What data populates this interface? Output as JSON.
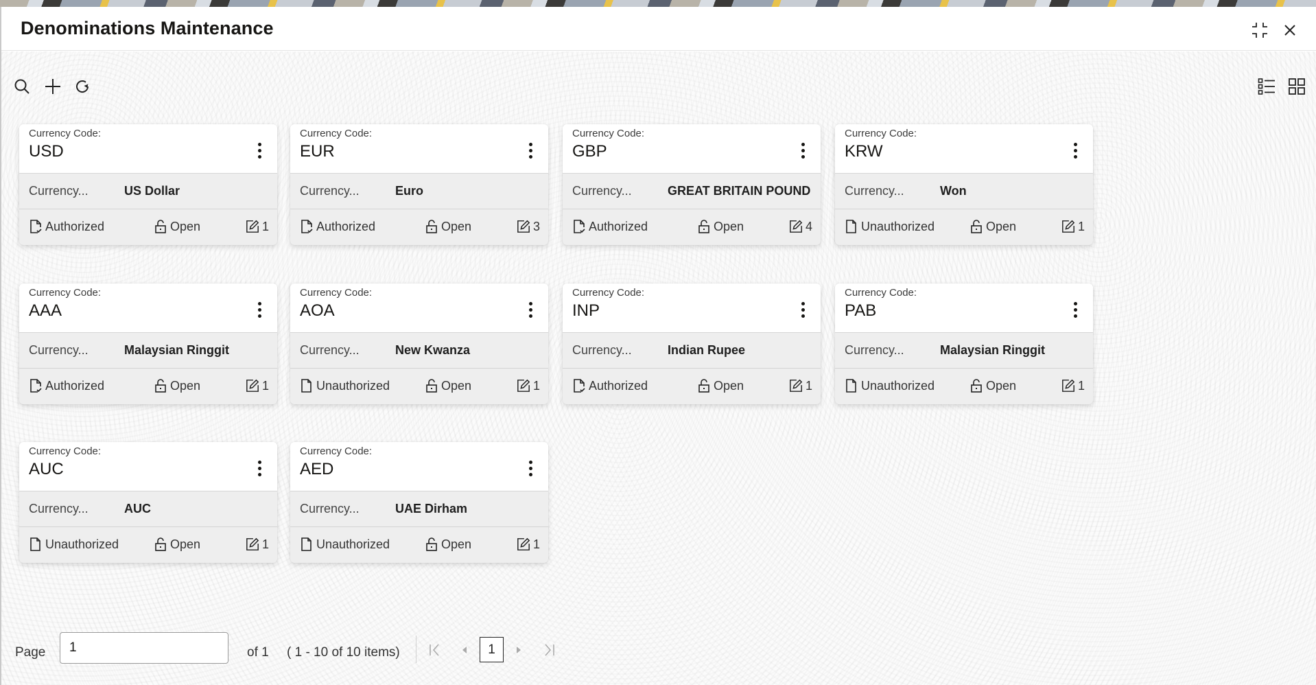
{
  "window": {
    "title": "Denominations Maintenance",
    "controls": {
      "minimize_icon": "compress-icon",
      "close_icon": "close-icon"
    }
  },
  "toolbar": {
    "left": [
      "search-icon",
      "add-icon",
      "refresh-icon"
    ],
    "right": [
      "list-view-icon",
      "grid-view-icon"
    ]
  },
  "card_labels": {
    "code_label": "Currency Code:",
    "name_label": "Currency..."
  },
  "cards": [
    {
      "code": "USD",
      "name": "US Dollar",
      "auth_status": "Authorized",
      "record_status": "Open",
      "modifications": "1"
    },
    {
      "code": "EUR",
      "name": "Euro",
      "auth_status": "Authorized",
      "record_status": "Open",
      "modifications": "3"
    },
    {
      "code": "GBP",
      "name": "GREAT BRITAIN POUND",
      "auth_status": "Authorized",
      "record_status": "Open",
      "modifications": "4"
    },
    {
      "code": "KRW",
      "name": "Won",
      "auth_status": "Unauthorized",
      "record_status": "Open",
      "modifications": "1"
    },
    {
      "code": "AAA",
      "name": "Malaysian Ringgit",
      "auth_status": "Authorized",
      "record_status": "Open",
      "modifications": "1"
    },
    {
      "code": "AOA",
      "name": "New Kwanza",
      "auth_status": "Unauthorized",
      "record_status": "Open",
      "modifications": "1"
    },
    {
      "code": "INP",
      "name": "Indian Rupee",
      "auth_status": "Authorized",
      "record_status": "Open",
      "modifications": "1"
    },
    {
      "code": "PAB",
      "name": "Malaysian Ringgit",
      "auth_status": "Unauthorized",
      "record_status": "Open",
      "modifications": "1"
    },
    {
      "code": "AUC",
      "name": "AUC",
      "auth_status": "Unauthorized",
      "record_status": "Open",
      "modifications": "1"
    },
    {
      "code": "AED",
      "name": "UAE Dirham",
      "auth_status": "Unauthorized",
      "record_status": "Open",
      "modifications": "1"
    }
  ],
  "pagination": {
    "page_label": "Page",
    "page_value": "1",
    "of_label": "of 1",
    "items_summary": "( 1 - 10 of 10 items)",
    "current_page": "1"
  }
}
